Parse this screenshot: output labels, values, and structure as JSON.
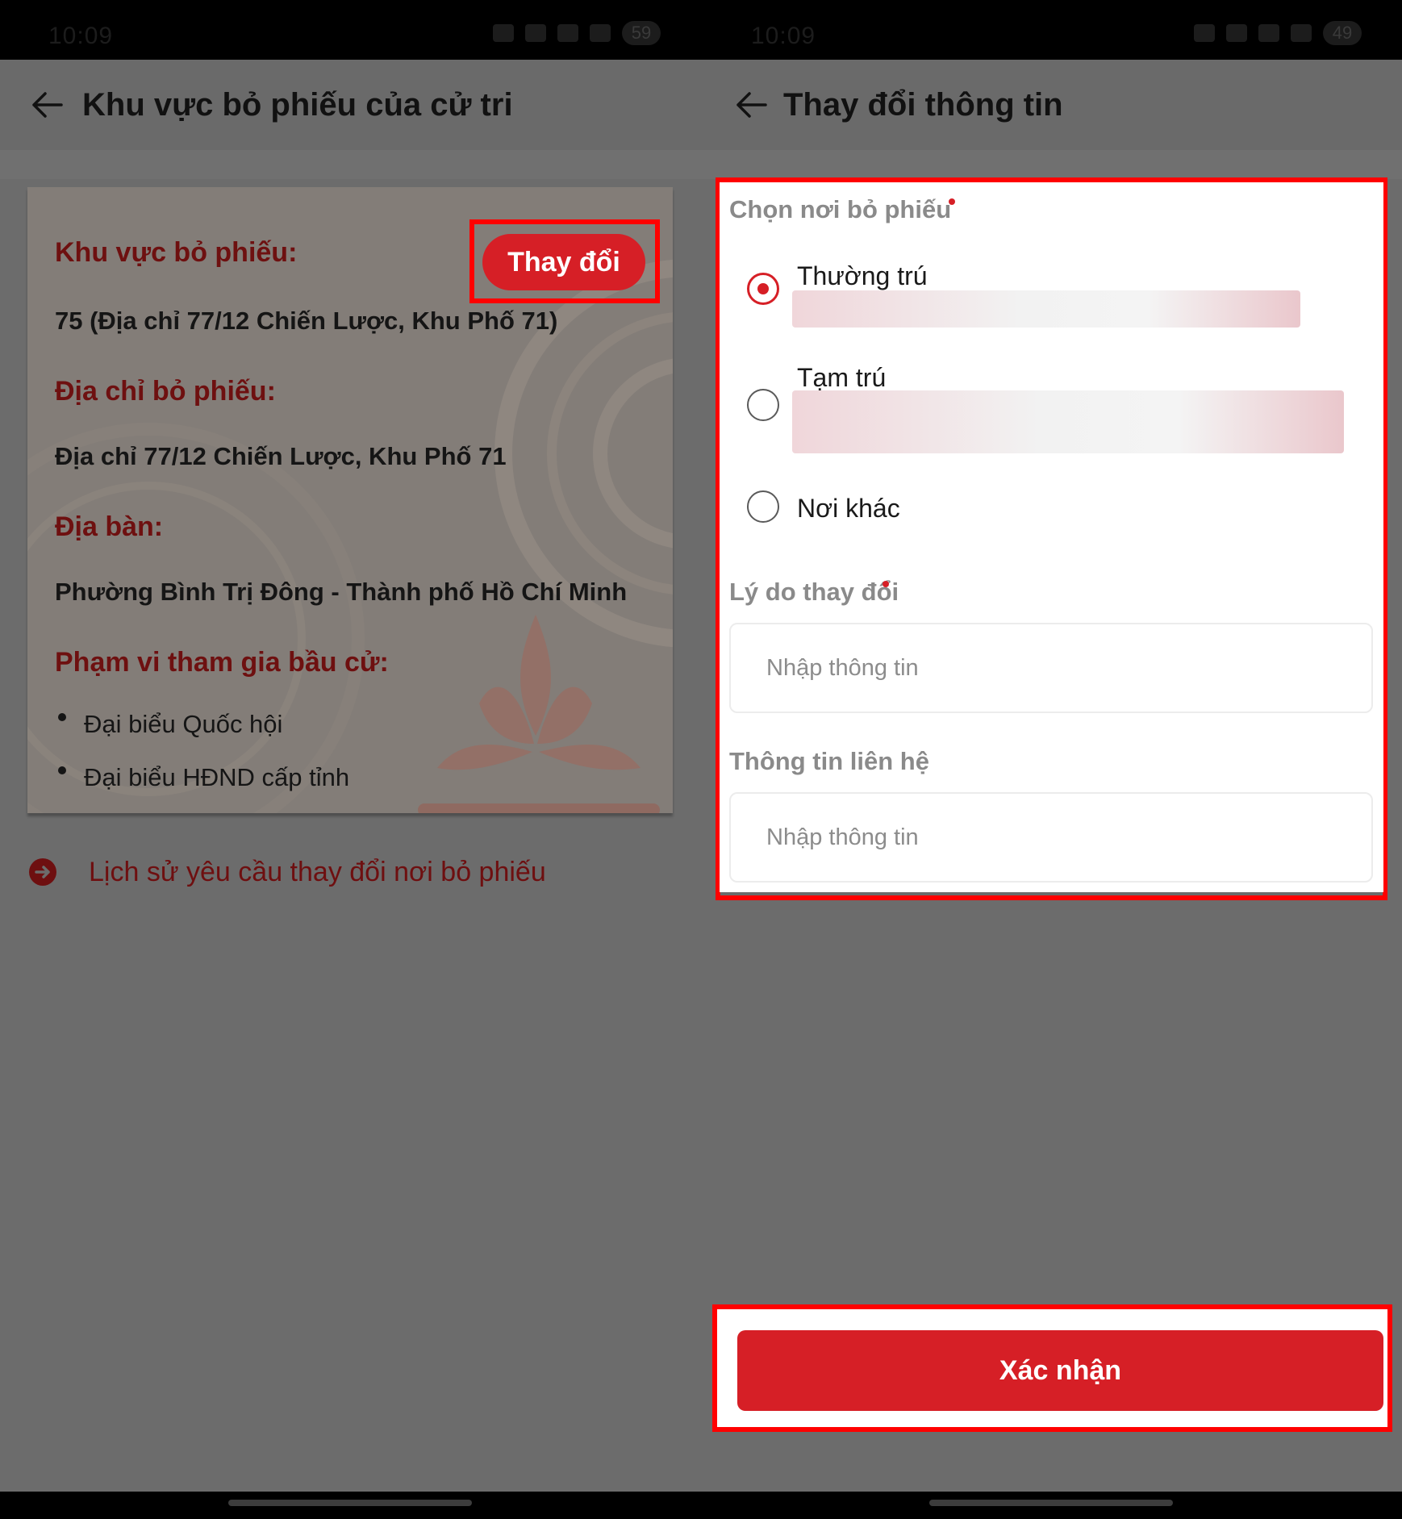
{
  "left": {
    "status_time": "10:09",
    "status_battery": "59",
    "title": "Khu vực bỏ phiếu của cử tri",
    "change_button": "Thay đổi",
    "fields": [
      {
        "label": "Khu vực bỏ phiếu:",
        "value": "75 (Địa chỉ 77/12 Chiến Lược, Khu Phố 71)"
      },
      {
        "label": "Địa chỉ bỏ phiếu:",
        "value": "Địa chỉ 77/12 Chiến Lược, Khu Phố 71"
      },
      {
        "label": "Địa bàn:",
        "value": "Phường Bình Trị Đông - Thành phố Hồ Chí Minh"
      }
    ],
    "scope_label": "Phạm vi tham gia bầu cử:",
    "scope_items": [
      "Đại biểu Quốc hội",
      "Đại biểu HĐND cấp tỉnh"
    ],
    "history_link": "Lịch sử yêu cầu thay đổi nơi bỏ phiếu"
  },
  "right": {
    "status_time": "10:09",
    "status_battery": "49",
    "title": "Thay đổi thông tin",
    "choose_place_label": "Chọn nơi bỏ phiếu",
    "options": [
      {
        "label": "Thường trú",
        "selected": true
      },
      {
        "label": "Tạm trú",
        "selected": false
      },
      {
        "label": "Nơi khác",
        "selected": false
      }
    ],
    "reason_label": "Lý do thay đổi",
    "reason_placeholder": "Nhập thông tin",
    "contact_label": "Thông tin liên hệ",
    "contact_placeholder": "Nhập thông tin",
    "confirm_button": "Xác nhận"
  },
  "colors": {
    "accent_red": "#d61f26",
    "highlight_red": "#ff0000",
    "dark_red_text": "#6e1010",
    "overlay_gray": "#6c6c6c"
  }
}
